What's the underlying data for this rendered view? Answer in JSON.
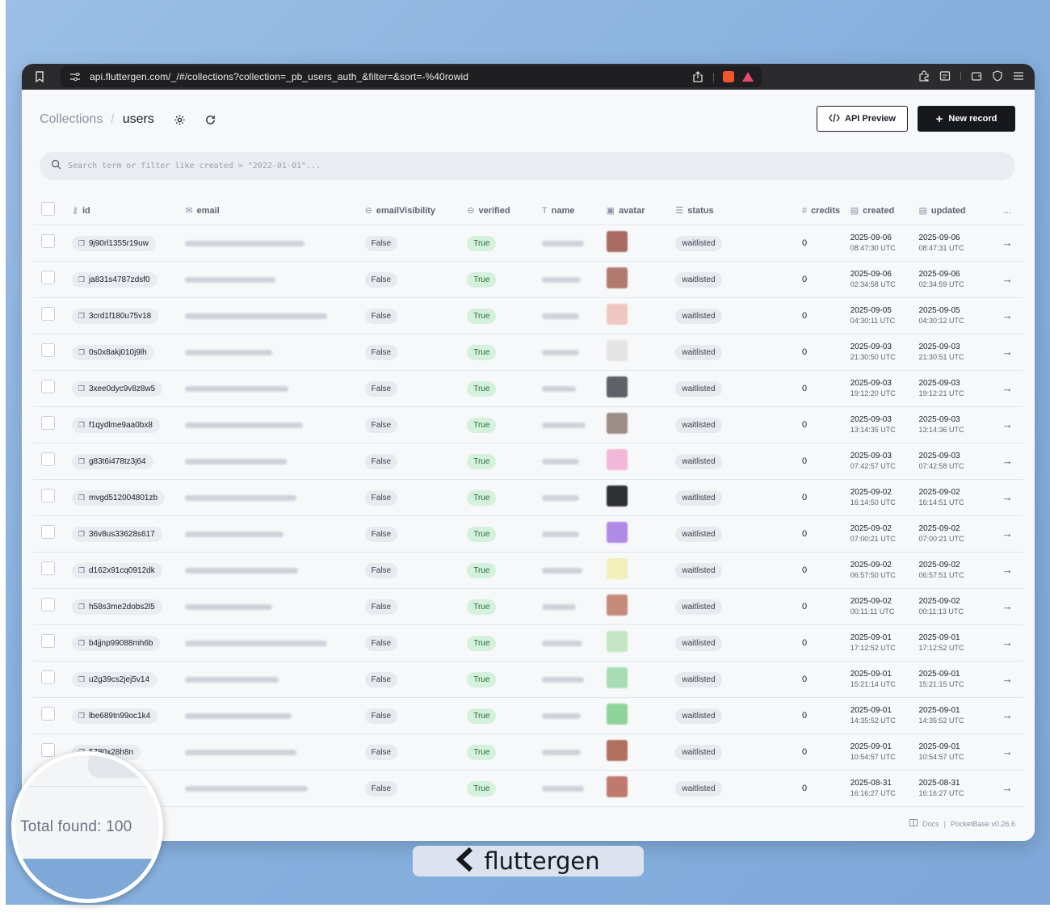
{
  "browser": {
    "url": "api.fluttergen.com/_/#/collections?collection=_pb_users_auth_&filter=&sort=-%40rowid"
  },
  "breadcrumb": {
    "root": "Collections",
    "sep": "/",
    "current": "users"
  },
  "buttons": {
    "api_preview": "API Preview",
    "new_record": "New record"
  },
  "search": {
    "placeholder": "Search term or filter like created > \"2022-01-01\"..."
  },
  "columns": {
    "id": "id",
    "email": "email",
    "emailVisibility": "emailVisibility",
    "verified": "verified",
    "name": "name",
    "avatar": "avatar",
    "status": "status",
    "credits": "credits",
    "created": "created",
    "updated": "updated",
    "more": "..."
  },
  "rows": [
    {
      "id": "9j90rl1355r19uw",
      "vis": "False",
      "verified": "True",
      "status": "waitlisted",
      "credits": "0",
      "created_d": "2025-09-06",
      "created_t": "08:47:30 UTC",
      "updated_d": "2025-09-06",
      "updated_t": "08:47:31 UTC",
      "avatar_color": "#a86b62"
    },
    {
      "id": "ja831s4787zdsf0",
      "vis": "False",
      "verified": "True",
      "status": "waitlisted",
      "credits": "0",
      "created_d": "2025-09-06",
      "created_t": "02:34:58 UTC",
      "updated_d": "2025-09-06",
      "updated_t": "02:34:59 UTC",
      "avatar_color": "#b27a6e"
    },
    {
      "id": "3crd1f180u75v18",
      "vis": "False",
      "verified": "True",
      "status": "waitlisted",
      "credits": "0",
      "created_d": "2025-09-05",
      "created_t": "04:30:11 UTC",
      "updated_d": "2025-09-05",
      "updated_t": "04:30:12 UTC",
      "avatar_color": "#f0c7c0"
    },
    {
      "id": "0s0x8akj010j9lh",
      "vis": "False",
      "verified": "True",
      "status": "waitlisted",
      "credits": "0",
      "created_d": "2025-09-03",
      "created_t": "21:30:50 UTC",
      "updated_d": "2025-09-03",
      "updated_t": "21:30:51 UTC",
      "avatar_color": "#e4e4e4"
    },
    {
      "id": "3xee0dyc9v8z8w5",
      "vis": "False",
      "verified": "True",
      "status": "waitlisted",
      "credits": "0",
      "created_d": "2025-09-03",
      "created_t": "19:12:20 UTC",
      "updated_d": "2025-09-03",
      "updated_t": "19:12:21 UTC",
      "avatar_color": "#5f6168"
    },
    {
      "id": "f1qydlme9aa0bx8",
      "vis": "False",
      "verified": "True",
      "status": "waitlisted",
      "credits": "0",
      "created_d": "2025-09-03",
      "created_t": "13:14:35 UTC",
      "updated_d": "2025-09-03",
      "updated_t": "13:14:36 UTC",
      "avatar_color": "#9c8e86"
    },
    {
      "id": "g83t6i478tz3j64",
      "vis": "False",
      "verified": "True",
      "status": "waitlisted",
      "credits": "0",
      "created_d": "2025-09-03",
      "created_t": "07:42:57 UTC",
      "updated_d": "2025-09-03",
      "updated_t": "07:42:58 UTC",
      "avatar_color": "#f2b8d9"
    },
    {
      "id": "mvgd512004801zb",
      "vis": "False",
      "verified": "True",
      "status": "waitlisted",
      "credits": "0",
      "created_d": "2025-09-02",
      "created_t": "16:14:50 UTC",
      "updated_d": "2025-09-02",
      "updated_t": "16:14:51 UTC",
      "avatar_color": "#2f3033"
    },
    {
      "id": "36v8us33628s617",
      "vis": "False",
      "verified": "True",
      "status": "waitlisted",
      "credits": "0",
      "created_d": "2025-09-02",
      "created_t": "07:00:21 UTC",
      "updated_d": "2025-09-02",
      "updated_t": "07:00:21 UTC",
      "avatar_color": "#b08ae6"
    },
    {
      "id": "d162x91cq0912dk",
      "vis": "False",
      "verified": "True",
      "status": "waitlisted",
      "credits": "0",
      "created_d": "2025-09-02",
      "created_t": "06:57:50 UTC",
      "updated_d": "2025-09-02",
      "updated_t": "06:57:51 UTC",
      "avatar_color": "#f3f0b8"
    },
    {
      "id": "h58s3me2dobs2l5",
      "vis": "False",
      "verified": "True",
      "status": "waitlisted",
      "credits": "0",
      "created_d": "2025-09-02",
      "created_t": "00:11:11 UTC",
      "updated_d": "2025-09-02",
      "updated_t": "00:11:13 UTC",
      "avatar_color": "#c48a7a"
    },
    {
      "id": "b4jjnp99088mh6b",
      "vis": "False",
      "verified": "True",
      "status": "waitlisted",
      "credits": "0",
      "created_d": "2025-09-01",
      "created_t": "17:12:52 UTC",
      "updated_d": "2025-09-01",
      "updated_t": "17:12:52 UTC",
      "avatar_color": "#c4e5c4"
    },
    {
      "id": "u2g39cs2jej5v14",
      "vis": "False",
      "verified": "True",
      "status": "waitlisted",
      "credits": "0",
      "created_d": "2025-09-01",
      "created_t": "15:21:14 UTC",
      "updated_d": "2025-09-01",
      "updated_t": "15:21:15 UTC",
      "avatar_color": "#a8dcb4"
    },
    {
      "id": "lbe689tn99oc1k4",
      "vis": "False",
      "verified": "True",
      "status": "waitlisted",
      "credits": "0",
      "created_d": "2025-09-01",
      "created_t": "14:35:52 UTC",
      "updated_d": "2025-09-01",
      "updated_t": "14:35:52 UTC",
      "avatar_color": "#8ed49a"
    },
    {
      "id": "5780x28h8n",
      "vis": "False",
      "verified": "True",
      "status": "waitlisted",
      "credits": "0",
      "created_d": "2025-09-01",
      "created_t": "10:54:57 UTC",
      "updated_d": "2025-09-01",
      "updated_t": "10:54:57 UTC",
      "avatar_color": "#b07060"
    },
    {
      "id": "",
      "vis": "False",
      "verified": "True",
      "status": "waitlisted",
      "credits": "0",
      "created_d": "2025-08-31",
      "created_t": "16:16:27 UTC",
      "updated_d": "2025-08-31",
      "updated_t": "16:16:27 UTC",
      "avatar_color": "#c0796f"
    }
  ],
  "footer": {
    "docs": "Docs",
    "sep": "|",
    "version": "PocketBase v0.26.6"
  },
  "magnifier": {
    "total": "Total found:  100"
  },
  "brand": {
    "name": "fluttergen"
  },
  "icons": {
    "bookmark": "bookmark-icon",
    "site": "site-settings-icon",
    "share": "share-icon",
    "gear": "gear-icon",
    "refresh": "refresh-icon",
    "search": "search-icon",
    "arrow": "arrow-right-icon"
  }
}
